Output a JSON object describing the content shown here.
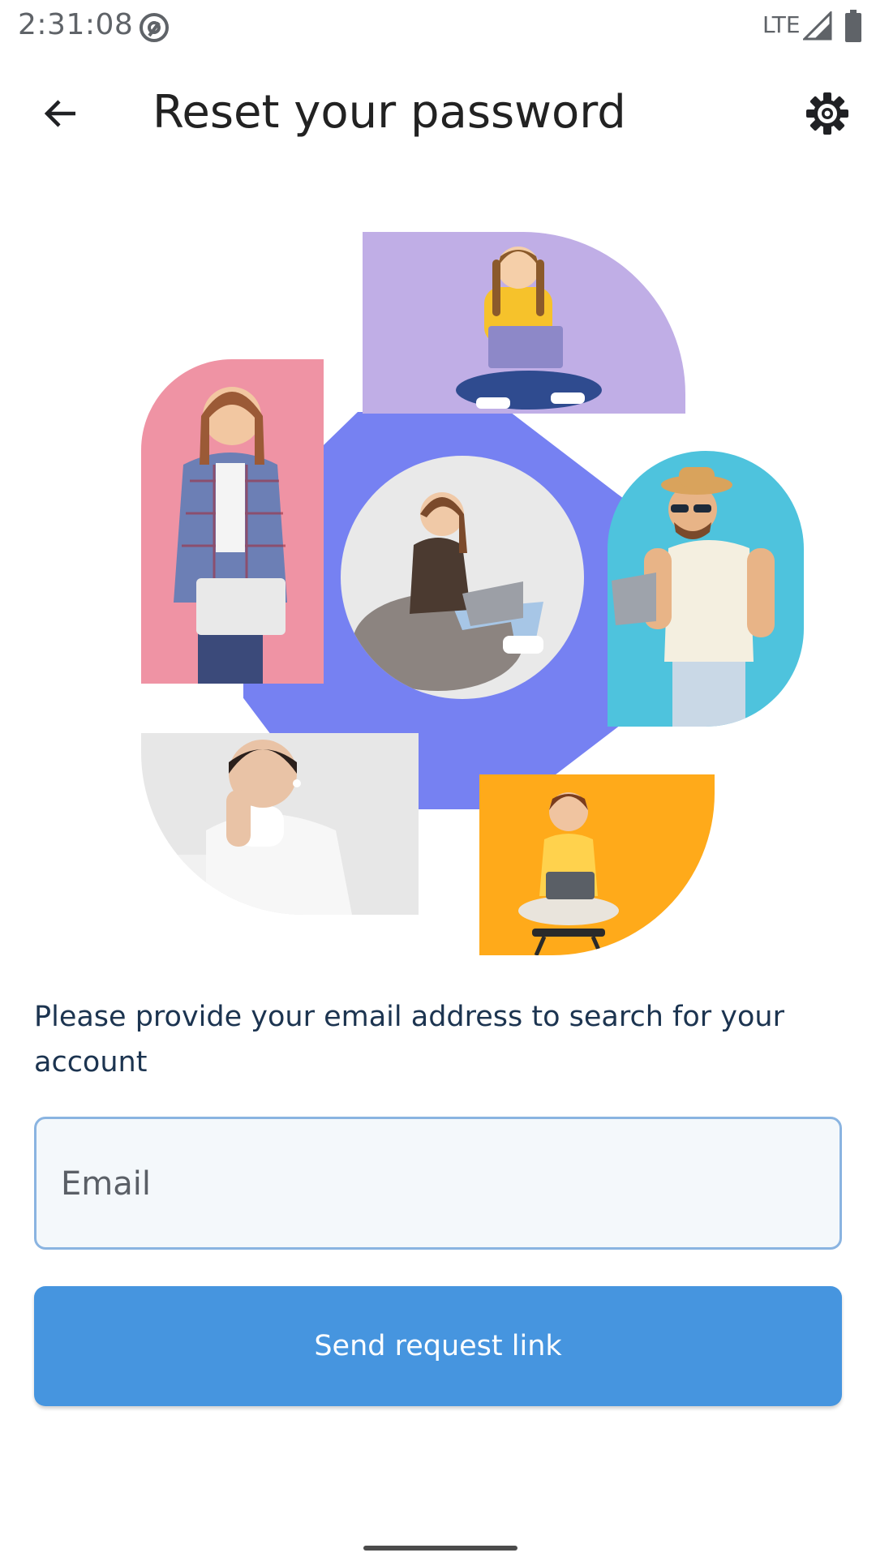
{
  "status_bar": {
    "time": "2:31:08",
    "network": "LTE",
    "icons": [
      "at-sign-icon",
      "signal-icon",
      "battery-icon"
    ]
  },
  "toolbar": {
    "title": "Reset your password",
    "back_icon": "arrow-left-icon",
    "settings_icon": "gear-icon"
  },
  "illustration": {
    "tiles": [
      "girl-with-laptop-photo",
      "woman-holding-laptop-photo",
      "girl-on-beanbag-photo",
      "man-with-laptop-photo",
      "woman-with-earbuds-photo",
      "boy-with-tablet-photo"
    ],
    "colors": {
      "purple": "#c0aee6",
      "pink": "#ef93a4",
      "hexagon": "#7681f2",
      "cyan": "#4ec3dd",
      "grey": "#e7e7e7",
      "orange": "#ffaa1a"
    }
  },
  "form": {
    "instruction": "Please provide your email address to search for your account",
    "email": {
      "value": "",
      "placeholder": "Email"
    },
    "submit_label": "Send request link"
  },
  "colors": {
    "accent": "#4695df",
    "field_border": "#8ab4e1",
    "instruction_text": "#1c3450"
  }
}
